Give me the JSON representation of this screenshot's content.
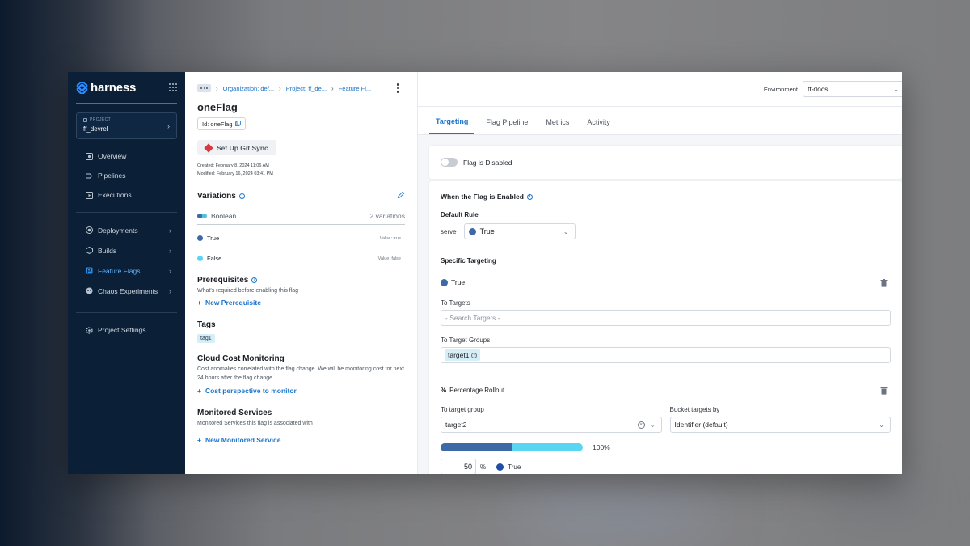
{
  "brand": {
    "name": "harness"
  },
  "project": {
    "kicker": "PROJECT",
    "name": "ff_devrel"
  },
  "nav": {
    "top": [
      {
        "label": "Overview",
        "icon": "overview-icon"
      },
      {
        "label": "Pipelines",
        "icon": "pipeline-icon"
      },
      {
        "label": "Executions",
        "icon": "executions-icon"
      }
    ],
    "modules": [
      {
        "label": "Deployments",
        "icon": "deployments-icon",
        "active": false
      },
      {
        "label": "Builds",
        "icon": "builds-icon",
        "active": false
      },
      {
        "label": "Feature Flags",
        "icon": "feature-flags-icon",
        "active": true
      },
      {
        "label": "Chaos Experiments",
        "icon": "chaos-icon",
        "active": false
      }
    ],
    "settings": {
      "label": "Project Settings",
      "icon": "gear-icon"
    }
  },
  "breadcrumb": {
    "items": [
      "Organization: def...",
      "Project: ff_de...",
      "Feature Fl..."
    ]
  },
  "flag": {
    "name": "oneFlag",
    "id_label": "Id: oneFlag",
    "git_sync_label": "Set Up Git Sync",
    "created": "Created: February 8, 2024 11:06 AM",
    "modified": "Modified: February 16, 2024 03:41 PM"
  },
  "variations": {
    "title": "Variations",
    "type": "Boolean",
    "count": "2 variations",
    "items": [
      {
        "name": "True",
        "value": "Value: true",
        "color": "#3e69a7"
      },
      {
        "name": "False",
        "value": "Value: false",
        "color": "#5ad6f2"
      }
    ]
  },
  "prerequisites": {
    "title": "Prerequisites",
    "description": "What's required before enabling this flag",
    "add_label": "New Prerequisite"
  },
  "tags": {
    "title": "Tags",
    "items": [
      "tag1"
    ]
  },
  "cost": {
    "title": "Cloud Cost Monitoring",
    "description": "Cost anomalies correlated with the flag change. We will be monitoring cost for next 24 hours after the flag change.",
    "add_label": "Cost perspective to monitor"
  },
  "monitored": {
    "title": "Monitored Services",
    "description": "Monitored Services this flag is associated with",
    "add_label": "New Monitored Service"
  },
  "environment": {
    "label": "Environment",
    "value": "ff-docs"
  },
  "tabs": [
    {
      "label": "Targeting",
      "active": true
    },
    {
      "label": "Flag Pipeline",
      "active": false
    },
    {
      "label": "Metrics",
      "active": false
    },
    {
      "label": "Activity",
      "active": false
    }
  ],
  "flag_state": {
    "label": "Flag is Disabled",
    "enabled": false
  },
  "rules": {
    "when_enabled": "When the Flag is Enabled",
    "default_rule_label": "Default Rule",
    "serve_label": "serve",
    "serve_value": "True",
    "specific_targeting": "Specific Targeting",
    "target_variation": "True",
    "to_targets_label": "To Targets",
    "to_targets_placeholder": "- Search Targets -",
    "to_target_groups_label": "To Target Groups",
    "target_groups": [
      "target1"
    ],
    "percentage_rollout": "Percentage Rollout",
    "to_target_group_label": "To target group",
    "to_target_group_value": "target2",
    "bucket_by_label": "Bucket targets by",
    "bucket_by_value": "Identifier (default)",
    "rollout_total": "100%",
    "rollout_true_pct": 50,
    "rollout_input_value": "50",
    "rollout_unit": "%",
    "rollout_variation": "True"
  },
  "colors": {
    "accent": "#1d74c9",
    "nav_bg": "#0b1f36",
    "true_variation": "#3e69a7",
    "false_variation": "#5ad6f2"
  }
}
